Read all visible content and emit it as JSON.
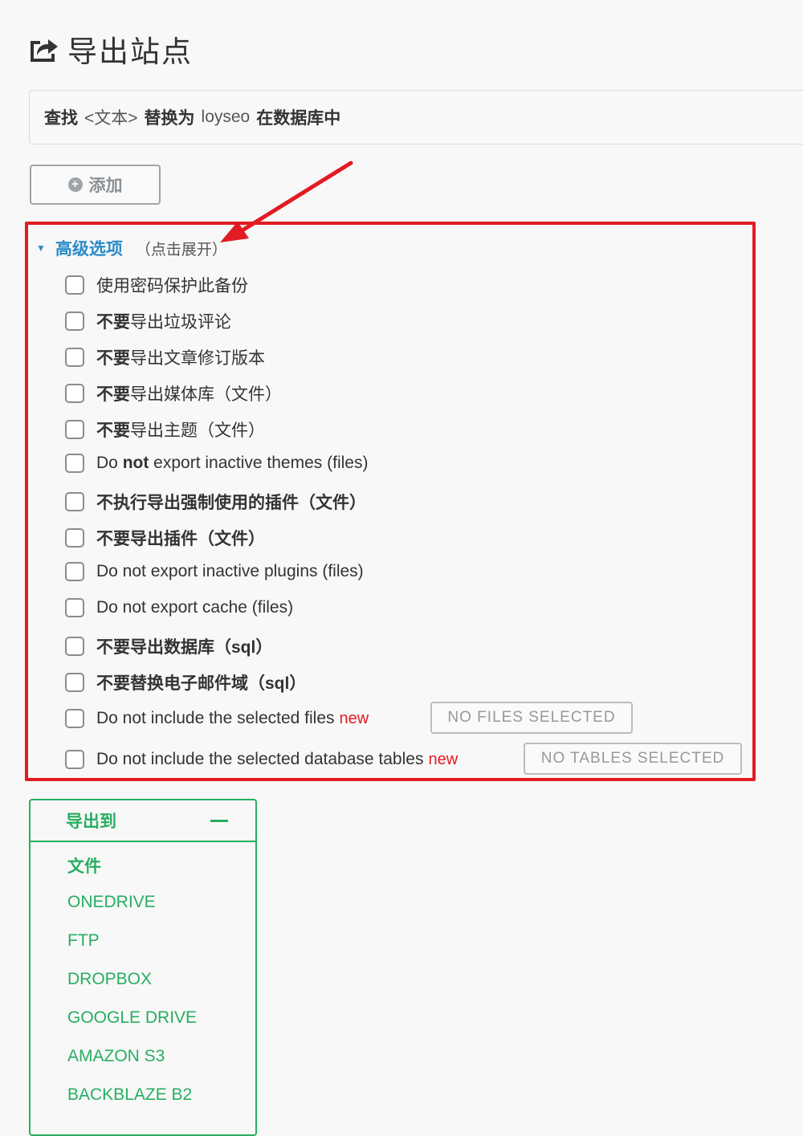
{
  "header": {
    "title": "导出站点",
    "icon": "export-icon"
  },
  "search": {
    "find": "查找",
    "text": "<文本>",
    "replace": "替换为",
    "value": "loyseo",
    "suffix": "在数据库中"
  },
  "add_button": {
    "label": "添加",
    "icon": "plus-circle-icon"
  },
  "advanced": {
    "title": "高级选项",
    "hint": "（点击展开）",
    "options": [
      {
        "label": "使用密码保护此备份"
      },
      {
        "bold": "不要",
        "label": "导出垃圾评论"
      },
      {
        "bold": "不要",
        "label": "导出文章修订版本"
      },
      {
        "bold": "不要",
        "label": "导出媒体库（文件）"
      },
      {
        "bold": "不要",
        "label": "导出主题（文件）"
      },
      {
        "pre": "Do ",
        "bold": "not",
        "label": " export inactive themes (files)"
      },
      {
        "bold": "不执行导出强制使用的插件（文件）",
        "label": ""
      },
      {
        "bold": "不要导出插件（文件）",
        "label": ""
      },
      {
        "label": "Do not export inactive plugins (files)"
      },
      {
        "label": "Do not export cache (files)"
      },
      {
        "bold": "不要导出数据库（sql）",
        "label": ""
      },
      {
        "bold": "不要替换电子邮件域（sql）",
        "label": ""
      },
      {
        "label": "Do not include the selected files",
        "new": "new",
        "button": "NO FILES SELECTED"
      },
      {
        "label": "Do not include the selected database tables",
        "new": "new",
        "button": "NO TABLES SELECTED"
      }
    ]
  },
  "export_to": {
    "title": "导出到",
    "items": [
      "文件",
      "ONEDRIVE",
      "FTP",
      "DROPBOX",
      "GOOGLE DRIVE",
      "AMAZON S3",
      "BACKBLAZE B2"
    ]
  },
  "colors": {
    "accent_red": "#e31b23",
    "link_blue": "#2a8bc9",
    "green": "#27ae60"
  }
}
